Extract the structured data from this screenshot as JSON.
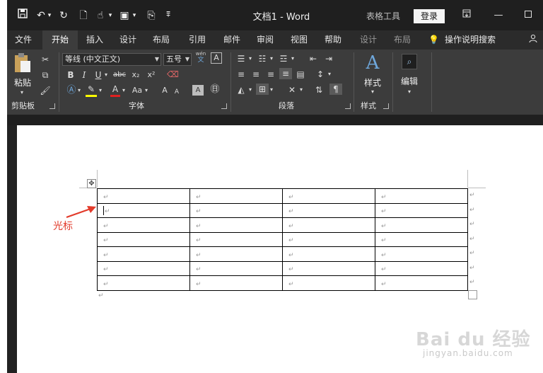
{
  "titlebar": {
    "document_title": "文档1  -  Word",
    "context_tools": "表格工具",
    "login": "登录",
    "qat": {
      "dropdown_arrow": "▾",
      "more": "⩱"
    }
  },
  "tabs": [
    {
      "label": "文件"
    },
    {
      "label": "开始"
    },
    {
      "label": "插入"
    },
    {
      "label": "设计"
    },
    {
      "label": "布局"
    },
    {
      "label": "引用"
    },
    {
      "label": "邮件"
    },
    {
      "label": "审阅"
    },
    {
      "label": "视图"
    },
    {
      "label": "帮助"
    },
    {
      "label": "设计"
    },
    {
      "label": "布局"
    }
  ],
  "tell_me": "操作说明搜索",
  "ribbon": {
    "clipboard": {
      "paste": "粘贴",
      "group": "剪贴板"
    },
    "font": {
      "font_name": "等线 (中文正文)",
      "font_size": "五号",
      "wen_top": "wén",
      "wen_bottom": "文",
      "A_box": "A",
      "bold": "B",
      "italic": "I",
      "underline": "U",
      "strike": "abc",
      "subscript": "x₂",
      "superscript": "x²",
      "font_color": "A",
      "change_case": "Aa",
      "grow": "A",
      "shrink": "A",
      "group": "字体"
    },
    "paragraph": {
      "group": "段落"
    },
    "styles": {
      "label": "样式",
      "group": "样式"
    },
    "editing": {
      "label": "编辑"
    }
  },
  "document": {
    "paragraph_mark": "↵",
    "rows": 7,
    "cols": 4,
    "annotation": "光标"
  },
  "watermark": {
    "line1": "Bai du 经验",
    "line2": "jingyan.baidu.com"
  },
  "colors": {
    "annotation": "#e23a2a",
    "titlebar": "#1f1f1f",
    "ribbon": "#3c3c3c",
    "active_tab": "#3c3c3c"
  }
}
